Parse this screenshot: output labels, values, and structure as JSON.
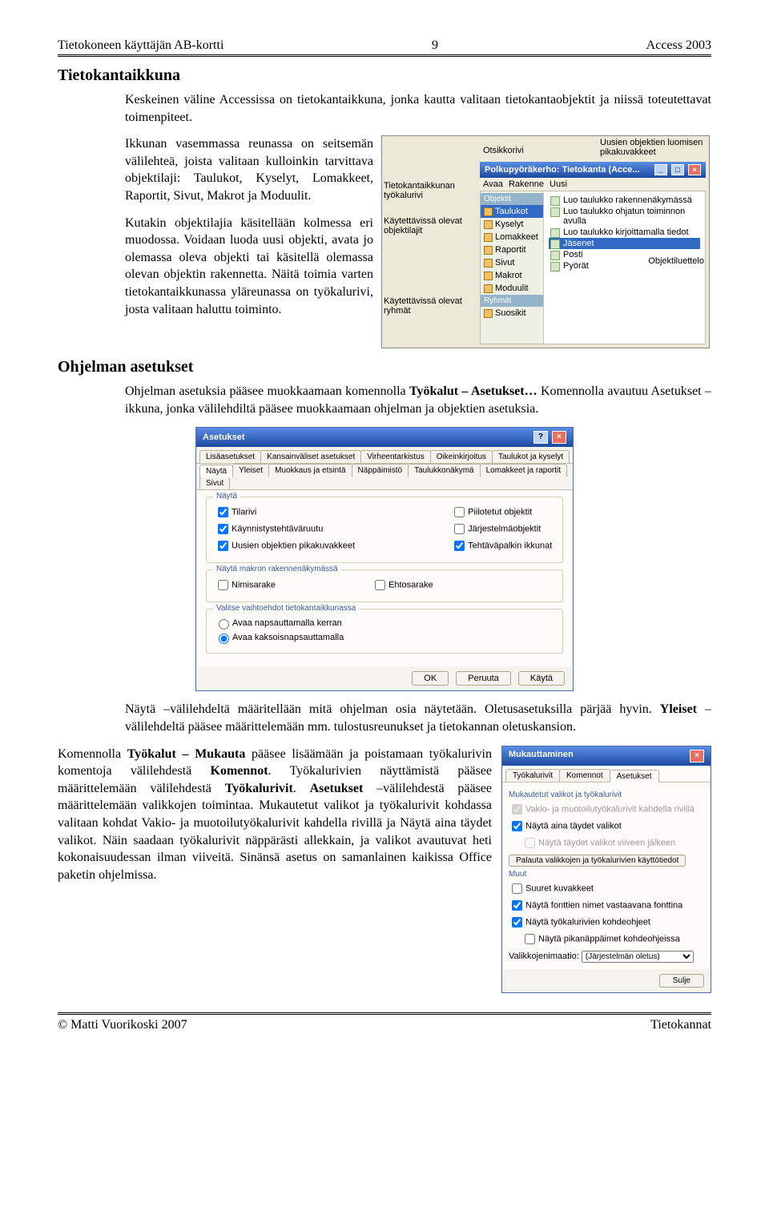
{
  "header": {
    "left": "Tietokoneen käyttäjän AB-kortti",
    "center": "9",
    "right": "Access 2003"
  },
  "section1": {
    "heading": "Tietokantaikkuna",
    "para1": "Keskeinen väline Accessissa on tietokantaikkuna, jonka kautta valitaan tietokantaobjektit ja niissä toteutettavat toimenpiteet.",
    "para2": "Ikkunan vasemmassa reunassa on seitsemän välilehteä, joista valitaan kulloinkin tarvittava objektilaji: Taulukot, Kyselyt, Lomakkeet, Raportit, Sivut, Makrot ja Moduulit.",
    "para3": "Kutakin objektilajia käsitellään kolmessa eri muodossa. Voidaan luoda uusi objekti, avata jo olemassa oleva objekti tai käsitellä olemassa olevan objektin rakennetta. Näitä toimia varten tietokantaikkunassa yläreunassa on työkalurivi, josta valitaan haluttu toiminto."
  },
  "dbshot": {
    "callout_otsikko": "Otsikkorivi",
    "callout_uusien": "Uusien objektien luomisen pikakuvakkeet",
    "callout_tyokalurivi": "Tietokantaikkunan työkalurivi",
    "callout_objektilajit": "Käytettävissä olevat objektilajit",
    "callout_ryhmat": "Käytettävissä olevat ryhmät",
    "callout_objektiluettelo": "Objektiluettelo",
    "title": "Polkupyöräkerho: Tietokanta (Acce...",
    "tb_avaa": "Avaa",
    "tb_rakenne": "Rakenne",
    "tb_uusi": "Uusi",
    "nav_hdr1": "Objektit",
    "nav_items": [
      "Taulukot",
      "Kyselyt",
      "Lomakkeet",
      "Raportit",
      "Sivut",
      "Makrot",
      "Moduulit"
    ],
    "nav_hdr2": "Ryhmät",
    "nav_item_suosikit": "Suosikit",
    "content_new1": "Luo taulukko rakennenäkymässä",
    "content_new2": "Luo taulukko ohjatun toiminnon avulla",
    "content_new3": "Luo taulukko kirjoittamalla tiedot",
    "content_obj1": "Jäsenet",
    "content_obj2": "Posti",
    "content_obj3": "Pyörät"
  },
  "section2": {
    "heading": "Ohjelman asetukset",
    "para1a": "Ohjelman asetuksia pääsee muokkaamaan komennolla ",
    "para1b": "Työkalut – Asetukset… ",
    "para1c": "Komennolla avautuu Asetukset –ikkuna, jonka välilehdiltä pääsee muokkaamaan ohjelman ja objektien asetuksia."
  },
  "asetukset": {
    "title": "Asetukset",
    "tab_row1": [
      "Lisäasetukset",
      "Kansainväliset asetukset",
      "Virheentarkistus",
      "Oikeinkirjoitus",
      "Taulukot ja kyselyt"
    ],
    "tab_row2": [
      "Näytä",
      "Yleiset",
      "Muokkaus ja etsintä",
      "Näppäimistö",
      "Taulukkonäkymä",
      "Lomakkeet ja raportit",
      "Sivut"
    ],
    "grp_nayto": "Näytä",
    "chk_tilarivi": "Tilarivi",
    "chk_kaynnistys": "Käynnistystehtäväruutu",
    "chk_uusien": "Uusien objektien pikakuvakkeet",
    "chk_piilot": "Piilotetut objektit",
    "chk_jarj": "Järjestelmäobjektit",
    "chk_tehtava": "Tehtäväpalkin ikkunat",
    "grp_makro": "Näytä makron rakennenäkymässä",
    "chk_nimisarake": "Nimisarake",
    "chk_ehtosarake": "Ehtosarake",
    "grp_valitse": "Valitse vaihtoehdot tietokantaikkunassa",
    "radio1": "Avaa napsauttamalla kerran",
    "radio2": "Avaa kaksoisnapsauttamalla",
    "btn_ok": "OK",
    "btn_peruuta": "Peruuta",
    "btn_kayta": "Käytä"
  },
  "section3": {
    "para1a": "Näytä –välilehdeltä määritellään mitä ohjelman osia näytetään. Oletusasetuksilla pärjää hyvin. ",
    "para1b": "Yleiset ",
    "para1c": "–välilehdeltä pääsee määrittelemään mm. tulostusreunukset ja tietokannan oletuskansion.",
    "para2a": "Komennolla ",
    "para2b": "Työkalut – Mukauta ",
    "para2c": "pääsee lisäämään ja poistamaan työkalurivin komentoja välilehdestä ",
    "para2d": "Komennot",
    "para2e": ". Työkalurivien näyttämistä pääsee määrittelemään välilehdestä ",
    "para2f": "Työkalurivit",
    "para2g": ". ",
    "para2h": "Asetukset ",
    "para2i": "–välilehdestä pääsee määrittelemään valikkojen toimintaa. Mukautetut valikot ja työkalurivit kohdassa valitaan kohdat Vakio- ja muotoilutyökalurivit kahdella rivillä ja Näytä aina täydet valikot. Näin saadaan työkalurivit näppärästi allekkain, ja valikot avautuvat heti kokonaisuudessan ilman viiveitä. Sinänsä asetus on samanlainen kaikissa Office paketin ohjelmissa."
  },
  "mukaut": {
    "title": "Mukauttaminen",
    "tabs": [
      "Työkalurivit",
      "Komennot",
      "Asetukset"
    ],
    "sec1": "Mukautetut valikot ja työkalurivit",
    "chk1": "Vakio- ja muotoilutyökalurivit kahdella rivillä",
    "chk2": "Näytä aina täydet valikot",
    "chk3": "Näytä täydet valikot viiveen jälkeen",
    "btn_palauta": "Palauta valikkojen ja työkalurivien käyttötiedot",
    "sec2": "Muut",
    "chk4": "Suuret kuvakkeet",
    "chk5": "Näytä fonttien nimet vastaavana fonttina",
    "chk6": "Näytä työkalurivien kohdeohjeet",
    "chk7": "Näytä pikanäppäimet kohdeohjeissa",
    "lbl_anim": "Valikkojenimaatio:",
    "sel_anim": "(Järjestelmän oletus)",
    "btn_sulje": "Sulje"
  },
  "footer": {
    "left": "© Matti Vuorikoski  2007",
    "right": "Tietokannat"
  }
}
